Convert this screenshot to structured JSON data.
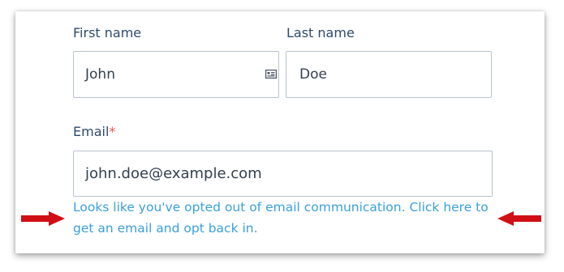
{
  "form": {
    "first_name": {
      "label": "First name",
      "value": "John",
      "icon": "contact-card-icon"
    },
    "last_name": {
      "label": "Last name",
      "value": "Doe"
    },
    "email": {
      "label": "Email",
      "required_marker": "*",
      "value": "john.doe@example.com",
      "help_text": "Looks like you've opted out of email communication. Click here to get an email and opt back in."
    }
  },
  "annotations": {
    "left_arrow": "arrow-right-icon",
    "right_arrow": "arrow-left-icon",
    "color": "#d10f16"
  },
  "colors": {
    "label": "#2f4a6b",
    "required": "#e0584a",
    "input_border": "#b8c3d1",
    "link": "#3aa0dc"
  }
}
